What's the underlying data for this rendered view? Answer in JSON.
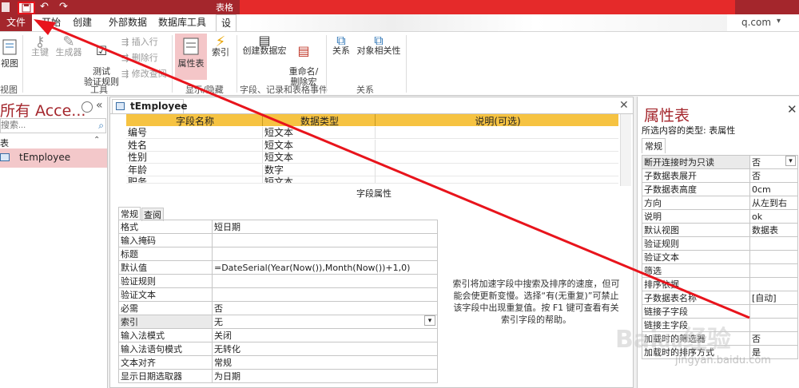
{
  "qat": {
    "save_icon": "save-icon",
    "undo_icon": "undo-icon",
    "redo_icon": "redo-icon"
  },
  "title_partial": "表格",
  "account_partial": "q.com",
  "tabs": {
    "file": "文件",
    "home": "开始",
    "create": "创建",
    "external": "外部数据",
    "dbtools": "数据库工具",
    "design_partial": "设"
  },
  "ribbon": {
    "view": "视图",
    "primary_key": "主键",
    "builder": "生成器",
    "test_rules": "测试\n验证规则",
    "insert_rows": "插入行",
    "delete_rows": "删除行",
    "modify_lookup": "修改查阅",
    "property_sheet": "属性表",
    "indexes": "索引",
    "create_macro": "创建数据宏",
    "rename_macro": "重命名/\n删除宏",
    "relationships": "关系",
    "dependencies": "对象相关性",
    "group_views": "视图",
    "group_tools": "工具",
    "group_showhide": "显示/隐藏",
    "group_events": "字段、记录和表格事件",
    "group_rel": "关系"
  },
  "nav": {
    "title": "所有 Acce...",
    "search_placeholder": "搜索...",
    "section": "表",
    "item": "tEmployee"
  },
  "doc": {
    "tab": "tEmployee",
    "headers": {
      "field_name": "字段名称",
      "data_type": "数据类型",
      "description": "说明(可选)"
    },
    "fields": [
      {
        "name": "编号",
        "type": "短文本"
      },
      {
        "name": "姓名",
        "type": "短文本"
      },
      {
        "name": "性别",
        "type": "短文本"
      },
      {
        "name": "年龄",
        "type": "数字"
      },
      {
        "name": "职务",
        "type": "短文本"
      }
    ],
    "field_props_label": "字段属性",
    "subtabs": {
      "general": "常规",
      "lookup": "查阅"
    },
    "props": [
      {
        "k": "格式",
        "v": "短日期"
      },
      {
        "k": "输入掩码",
        "v": ""
      },
      {
        "k": "标题",
        "v": ""
      },
      {
        "k": "默认值",
        "v": "=DateSerial(Year(Now()),Month(Now())+1,0)"
      },
      {
        "k": "验证规则",
        "v": ""
      },
      {
        "k": "验证文本",
        "v": ""
      },
      {
        "k": "必需",
        "v": "否"
      },
      {
        "k": "索引",
        "v": "无"
      },
      {
        "k": "输入法模式",
        "v": "关闭"
      },
      {
        "k": "输入法语句模式",
        "v": "无转化"
      },
      {
        "k": "文本对齐",
        "v": "常规"
      },
      {
        "k": "显示日期选取器",
        "v": "为日期"
      }
    ],
    "help": "索引将加速字段中搜索及排序的速度，但可能会使更新变慢。选择“有(无重复)”可禁止该字段中出现重复值。按 F1 键可查看有关索引字段的帮助。"
  },
  "props_pane": {
    "title": "属性表",
    "subtitle": "所选内容的类型: 表属性",
    "tab": "常规",
    "rows": [
      {
        "k": "断开连接时为只读",
        "v": "否"
      },
      {
        "k": "子数据表展开",
        "v": "否"
      },
      {
        "k": "子数据表高度",
        "v": "0cm"
      },
      {
        "k": "方向",
        "v": "从左到右"
      },
      {
        "k": "说明",
        "v": "ok"
      },
      {
        "k": "默认视图",
        "v": "数据表"
      },
      {
        "k": "验证规则",
        "v": ""
      },
      {
        "k": "验证文本",
        "v": ""
      },
      {
        "k": "筛选",
        "v": ""
      },
      {
        "k": "排序依据",
        "v": ""
      },
      {
        "k": "子数据表名称",
        "v": "[自动]"
      },
      {
        "k": "链接子字段",
        "v": ""
      },
      {
        "k": "链接主字段",
        "v": ""
      },
      {
        "k": "加载时的筛选器",
        "v": "否"
      },
      {
        "k": "加载时的排序方式",
        "v": "是"
      }
    ]
  },
  "watermark": "Baidu经验 jingyan.baidu.com",
  "colors": {
    "accent": "#a4262c",
    "header_yellow": "#f6c342",
    "arrow": "#e8141c"
  }
}
